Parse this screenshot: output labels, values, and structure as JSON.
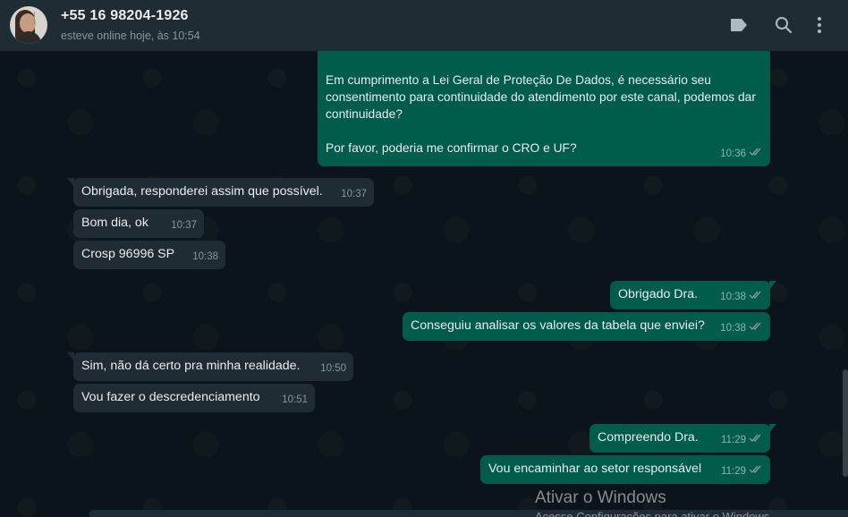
{
  "header": {
    "contact_name": "+55 16 98204-1926",
    "status": "esteve online hoje, às 10:54",
    "icons": [
      "label-icon",
      "search-icon",
      "menu-icon"
    ]
  },
  "messages": [
    {
      "direction": "out",
      "text": "Bom dia Dra. Thais\n\nEm cumprimento a Lei Geral de Proteção De Dados, é necessário seu consentimento para continuidade do atendimento por este canal, podemos dar continuidade?\n\nPor favor, poderia me confirmar o CRO e UF?",
      "time": "10:36",
      "status_icon": "double-check-icon"
    },
    {
      "direction": "in",
      "text": "Obrigada, responderei assim que possível.",
      "time": "10:37"
    },
    {
      "direction": "in",
      "text": "Bom dia, ok",
      "time": "10:37"
    },
    {
      "direction": "in",
      "text": "Crosp 96996 SP",
      "time": "10:38"
    },
    {
      "direction": "out",
      "text": "Obrigado Dra.",
      "time": "10:38",
      "status_icon": "double-check-icon"
    },
    {
      "direction": "out",
      "text": "Conseguiu analisar os valores da tabela que enviei?",
      "time": "10:38",
      "status_icon": "double-check-icon"
    },
    {
      "direction": "in",
      "text": "Sim, não dá certo pra minha realidade.",
      "time": "10:50"
    },
    {
      "direction": "in",
      "text": "Vou fazer o descredenciamento",
      "time": "10:51"
    },
    {
      "direction": "out",
      "text": "Compreendo Dra.",
      "time": "11:29",
      "status_icon": "double-check-icon"
    },
    {
      "direction": "out",
      "text": "Vou encaminhar ao setor responsável",
      "time": "11:29",
      "status_icon": "double-check-icon"
    }
  ],
  "watermark": {
    "title": "Ativar o Windows",
    "subtitle": "Acesse Configurações para ativar o Windows."
  },
  "colors": {
    "header_bg": "#202c33",
    "chat_bg": "#0b141a",
    "incoming_bubble": "#202c33",
    "outgoing_bubble": "#005c4b",
    "read_check": "#8696a0"
  }
}
